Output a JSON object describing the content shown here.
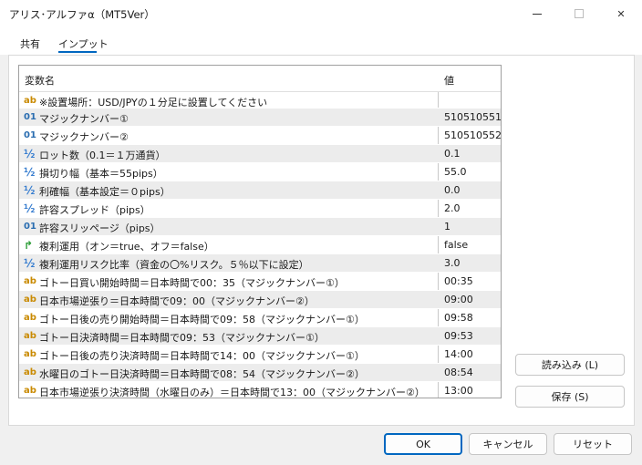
{
  "window": {
    "title": "アリス･アルファα（MT5Ver）",
    "minimize": "—",
    "maximize": "☐",
    "close": "✕"
  },
  "tabs": [
    {
      "label": "共有"
    },
    {
      "label": "インプット",
      "active": true
    }
  ],
  "grid": {
    "headers": {
      "name": "変数名",
      "value": "値"
    },
    "rows": [
      {
        "type": "ab",
        "name": "※設置場所：USD/JPYの１分足に設置してください",
        "value": ""
      },
      {
        "type": "01",
        "name": "マジックナンバー①",
        "value": "510510551"
      },
      {
        "type": "01",
        "name": "マジックナンバー②",
        "value": "510510552"
      },
      {
        "type": "½",
        "name": "ロット数（0.1＝１万通貨）",
        "value": "0.1"
      },
      {
        "type": "½",
        "name": "損切り幅（基本＝55pips）",
        "value": "55.0"
      },
      {
        "type": "½",
        "name": "利確幅（基本設定＝０pips）",
        "value": "0.0"
      },
      {
        "type": "½",
        "name": "許容スプレッド（pips）",
        "value": "2.0"
      },
      {
        "type": "01",
        "name": "許容スリッページ（pips）",
        "value": "1"
      },
      {
        "type": "bool",
        "name": "複利運用（オン＝true、オフ＝false）",
        "value": "false"
      },
      {
        "type": "½",
        "name": "複利運用リスク比率（資金の〇%リスク。５％以下に設定）",
        "value": "3.0"
      },
      {
        "type": "ab",
        "name": "ゴトー日買い開始時間＝日本時間で00：35（マジックナンバー①）",
        "value": "00:35"
      },
      {
        "type": "ab",
        "name": "日本市場逆張り＝日本時間で09：00（マジックナンバー②）",
        "value": "09:00"
      },
      {
        "type": "ab",
        "name": "ゴトー日後の売り開始時間＝日本時間で09：58（マジックナンバー①）",
        "value": "09:58"
      },
      {
        "type": "ab",
        "name": "ゴトー日決済時間＝日本時間で09：53（マジックナンバー①）",
        "value": "09:53"
      },
      {
        "type": "ab",
        "name": "ゴトー日後の売り決済時間＝日本時間で14：00（マジックナンバー①）",
        "value": "14:00"
      },
      {
        "type": "ab",
        "name": "水曜日のゴトー日決済時間＝日本時間で08：54（マジックナンバー②）",
        "value": "08:54"
      },
      {
        "type": "ab",
        "name": "日本市場逆張り決済時間（水曜日のみ）＝日本時間で13：00（マジックナンバー②）",
        "value": "13:00"
      }
    ]
  },
  "icons": {
    "ab": "ab",
    "01": "01",
    "half": "½",
    "bool": "↱"
  },
  "buttons": {
    "load": "読み込み (L)",
    "save": "保存 (S)",
    "ok": "OK",
    "cancel": "キャンセル",
    "reset": "リセット"
  },
  "colors": {
    "accent": "#0067c0",
    "ab_icon": "#c98a00",
    "num_icon": "#2a6db0",
    "bool_icon": "#2f9e3a",
    "alt_row": "#ececec"
  }
}
